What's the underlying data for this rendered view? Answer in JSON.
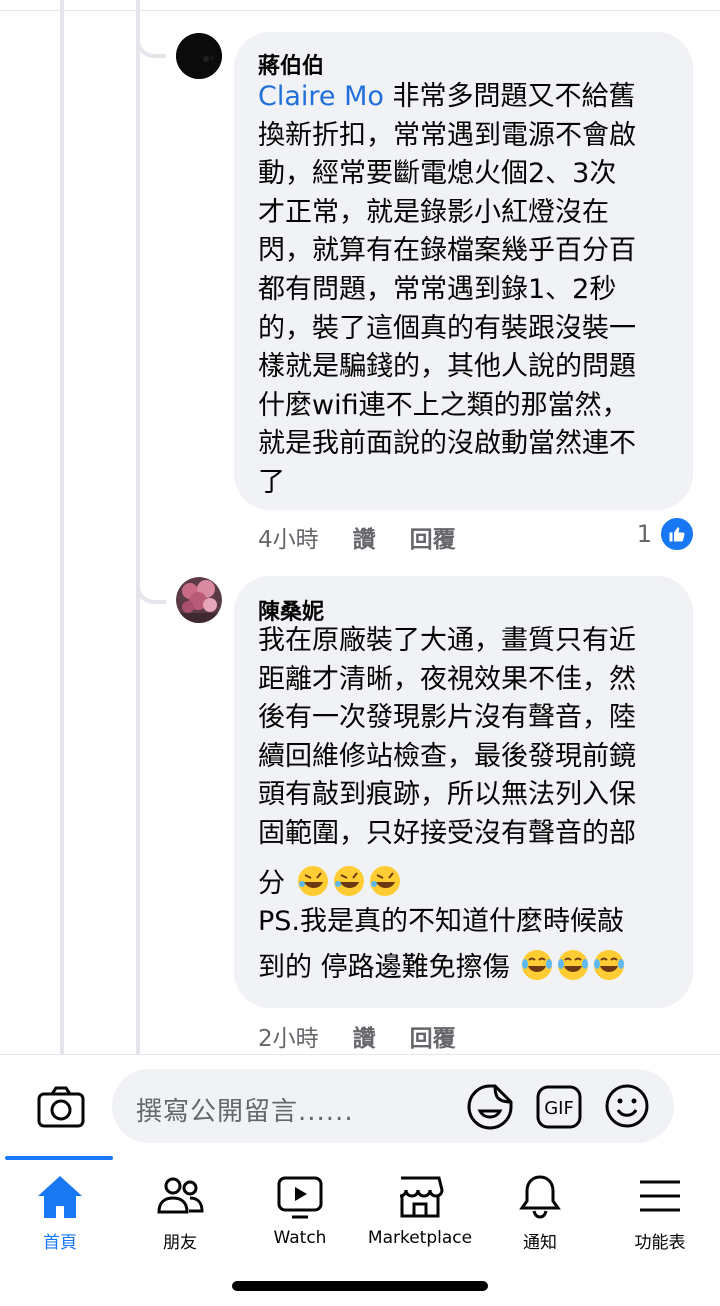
{
  "comments": [
    {
      "author": "蔣伯伯",
      "mention": "Claire Mo",
      "lines": [
        " 非常多問題又不給舊",
        "換新折扣，常常遇到電源不會啟",
        "動，經常要斷電熄火個2、3次",
        "才正常，就是錄影小紅燈沒在",
        "閃，就算有在錄檔案幾乎百分百",
        "都有問題，常常遇到錄1、2秒",
        "的，裝了這個真的有裝跟沒裝一",
        "樣就是騙錢的，其他人說的問題",
        "什麼wifi連不上之類的那當然，",
        "就是我前面說的沒啟動當然連不",
        "了"
      ],
      "time": "4小時",
      "like_label": "讚",
      "reply_label": "回覆",
      "reaction_count": "1"
    },
    {
      "author": "陳桑妮",
      "lines": [
        "我在原廠裝了大通，畫質只有近",
        "距離才清晰，夜視效果不佳，然",
        "後有一次發現影片沒有聲音，陸",
        "續回維修站檢查，最後發現前鏡",
        "頭有敲到痕跡，所以無法列入保",
        "固範圍，只好接受沒有聲音的部",
        "分",
        "PS.我是真的不知道什麼時候敲",
        "到的 停路邊難免擦傷"
      ],
      "emoji_line7": "rolling-on-floor-laughing x3",
      "emoji_line9": "tears-of-joy x3",
      "time": "2小時",
      "like_label": "讚",
      "reply_label": "回覆"
    }
  ],
  "composer": {
    "placeholder": "撰寫公開留言......",
    "icons": [
      "camera-icon",
      "sticker-icon",
      "gif-icon",
      "emoji-icon"
    ],
    "gif_label": "GIF"
  },
  "tabs": [
    {
      "label": "首頁",
      "icon": "home-icon",
      "active": true
    },
    {
      "label": "朋友",
      "icon": "friends-icon",
      "active": false
    },
    {
      "label": "Watch",
      "icon": "watch-icon",
      "active": false
    },
    {
      "label": "Marketplace",
      "icon": "marketplace-icon",
      "active": false
    },
    {
      "label": "通知",
      "icon": "bell-icon",
      "active": false
    },
    {
      "label": "功能表",
      "icon": "menu-icon",
      "active": false
    }
  ],
  "colors": {
    "accent": "#1877f2",
    "mention": "#216fdb",
    "bubble": "#f0f2f5",
    "meta": "#65676b"
  }
}
